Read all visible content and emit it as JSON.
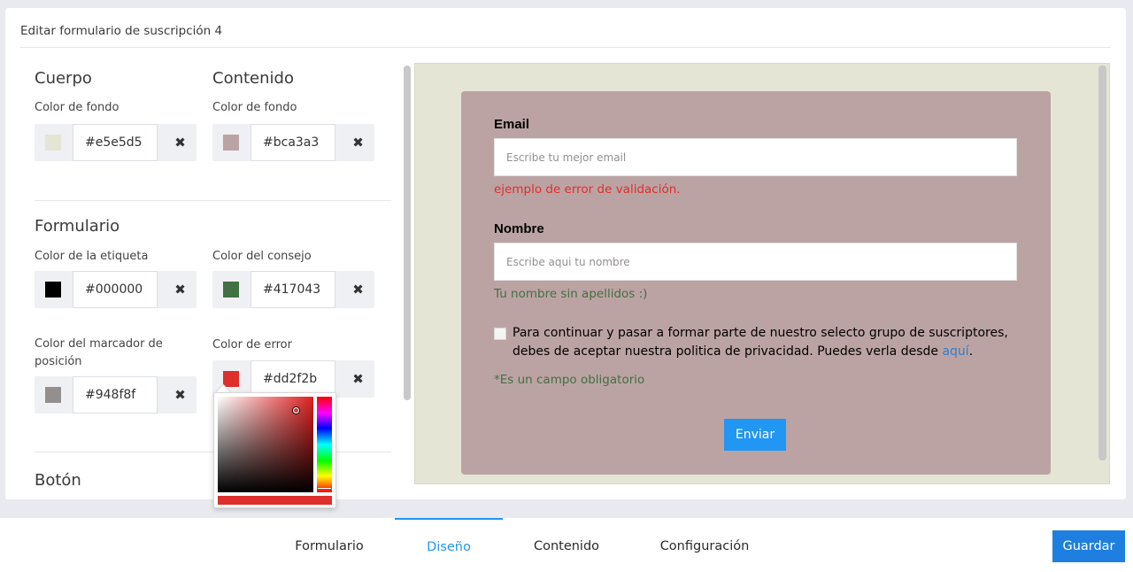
{
  "header": {
    "title": "Editar formulario de suscripción 4"
  },
  "settings": {
    "body_section": {
      "title": "Cuerpo",
      "bg_label": "Color de fondo",
      "bg_value": "#e5e5d5"
    },
    "content_section": {
      "title": "Contenido",
      "bg_label": "Color de fondo",
      "bg_value": "#bca3a3"
    },
    "form_section": {
      "title": "Formulario",
      "label_color_label": "Color de la etiqueta",
      "label_color_value": "#000000",
      "hint_color_label": "Color del consejo",
      "hint_color_value": "#417043",
      "placeholder_color_label": "Color del marcador de posición",
      "placeholder_color_value": "#948f8f",
      "error_color_label": "Color de error",
      "error_color_value": "#dd2f2b"
    },
    "button_section": {
      "title": "Botón"
    },
    "clear_icon": "✖"
  },
  "preview": {
    "email_label": "Email",
    "email_placeholder": "Escribe tu mejor email",
    "email_error": "ejemplo de error de validación.",
    "name_label": "Nombre",
    "name_placeholder": "Escribe aqui tu nombre",
    "name_hint": "Tu nombre sin apellidos :)",
    "consent_text": "Para continuar y pasar a formar parte de nuestro selecto grupo de suscriptores, debes de aceptar nuestra politica de privacidad. Puedes verla desde ",
    "consent_link": "aquí",
    "consent_end": ".",
    "required_note": "*Es un campo obligatorio",
    "submit_label": "Enviar"
  },
  "color_picker": {
    "selected_color": "#dd2f2b"
  },
  "tabs": [
    {
      "label": "Formulario",
      "active": false
    },
    {
      "label": "Diseño",
      "active": true
    },
    {
      "label": "Contenido",
      "active": false
    },
    {
      "label": "Configuración",
      "active": false
    }
  ],
  "save_label": "Guardar"
}
